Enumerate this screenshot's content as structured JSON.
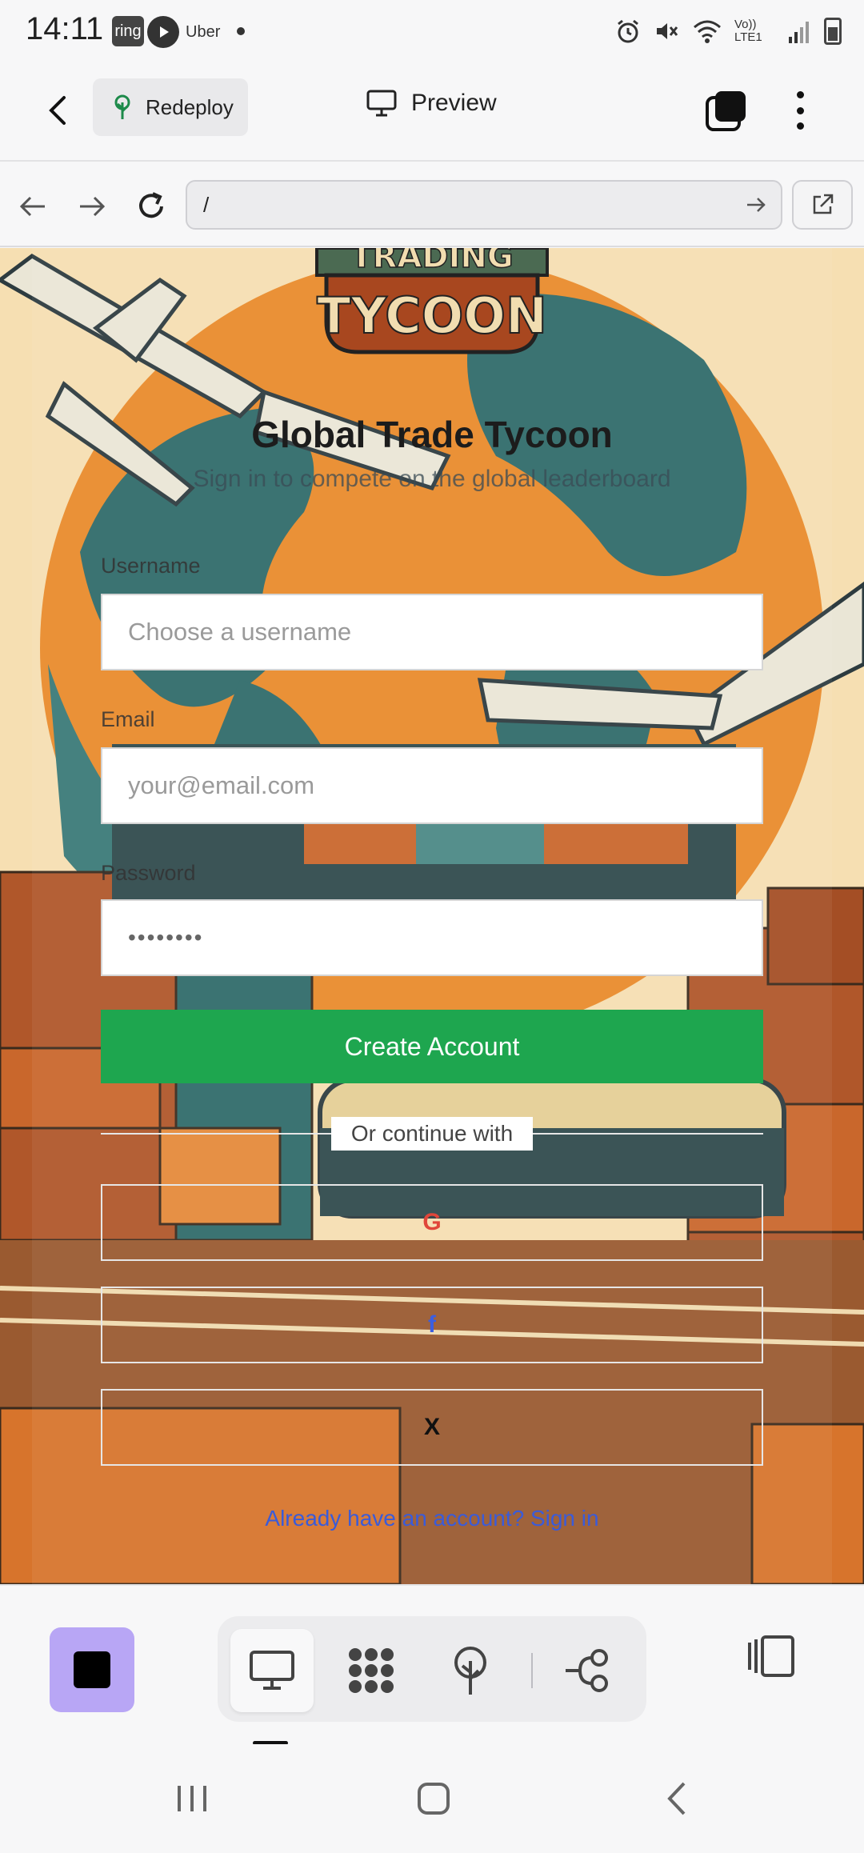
{
  "status_bar": {
    "time": "14:11",
    "ring_label": "ring",
    "uber_label": "Uber",
    "volte_label": "Vo)) LTE1"
  },
  "app_bar": {
    "redeploy_label": "Redeploy",
    "preview_label": "Preview"
  },
  "browser": {
    "url": "/"
  },
  "page": {
    "logo_text": "TRADING TYCOON",
    "title": "Global Trade Tycoon",
    "subtitle": "Sign in to compete on the global leaderboard",
    "username_label": "Username",
    "username_placeholder": "Choose a username",
    "email_label": "Email",
    "email_placeholder": "your@email.com",
    "password_label": "Password",
    "password_value": "••••••••",
    "create_button": "Create Account",
    "divider_text": "Or continue with",
    "social": {
      "google": "G",
      "facebook": "f",
      "x": "X"
    },
    "signin_link": "Already have an account? Sign in"
  },
  "colors": {
    "primary_green": "#1ea64f",
    "link_blue": "#3a5bd9",
    "stop_purple": "#b8a6f5",
    "google_red": "#e0463a",
    "facebook_blue": "#3b5ee0"
  },
  "icons": {
    "back": "chevron-left-icon",
    "redeploy": "tree-deploy-icon",
    "preview": "monitor-icon",
    "tabs": "tabs-icon",
    "more": "more-vertical-icon",
    "nav_back": "arrow-left-icon",
    "nav_forward": "arrow-right-icon",
    "reload": "reload-icon",
    "go": "arrow-right-icon",
    "open_external": "external-link-icon",
    "stop": "stop-icon",
    "desktop_view": "monitor-icon",
    "grid_view": "dots-grid-icon",
    "deploy_view": "tree-deploy-icon",
    "flow_view": "branch-icon",
    "panel": "side-panel-icon"
  }
}
